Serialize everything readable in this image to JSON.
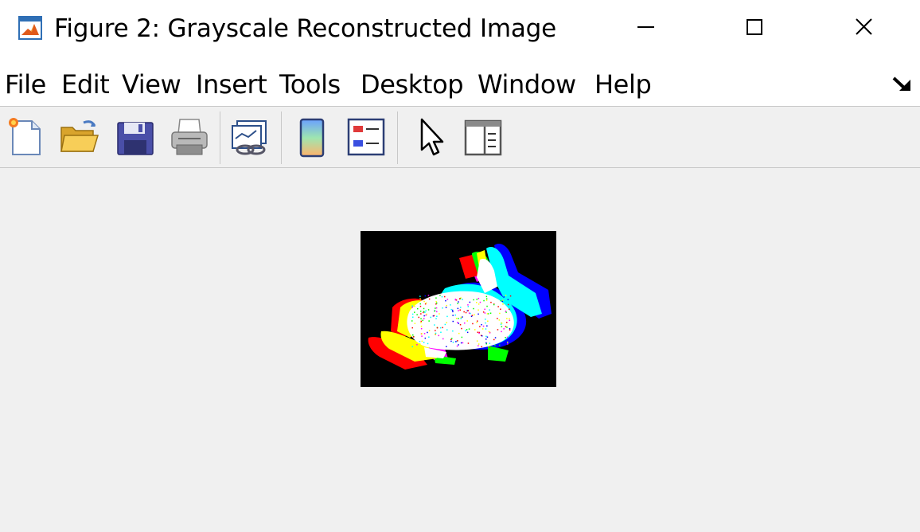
{
  "window": {
    "title": "Figure 2: Grayscale Reconstructed Image",
    "buttons": [
      "minimize",
      "maximize",
      "close"
    ]
  },
  "menubar": {
    "items": [
      "File",
      "Edit",
      "View",
      "Insert",
      "Tools",
      "Desktop",
      "Window",
      "Help"
    ]
  },
  "toolbar": {
    "tools": [
      {
        "id": "new-figure",
        "icon": "new-file-icon"
      },
      {
        "id": "open-file",
        "icon": "folder-open-icon"
      },
      {
        "id": "save-figure",
        "icon": "floppy-disk-icon"
      },
      {
        "id": "print-figure",
        "icon": "printer-icon"
      },
      {
        "id": "link-plot",
        "icon": "link-plot-icon"
      },
      {
        "id": "insert-colorbar",
        "icon": "colorbar-icon"
      },
      {
        "id": "insert-legend",
        "icon": "legend-icon"
      },
      {
        "id": "edit-plot",
        "icon": "pointer-arrow-icon"
      },
      {
        "id": "property-inspector",
        "icon": "panel-icon"
      }
    ]
  },
  "figure": {
    "image_description_colors": [
      "#ff0000",
      "#ffff00",
      "#00ff00",
      "#00ffff",
      "#0000ff",
      "#ff00ff",
      "#ffffff"
    ],
    "background": "#000000"
  }
}
